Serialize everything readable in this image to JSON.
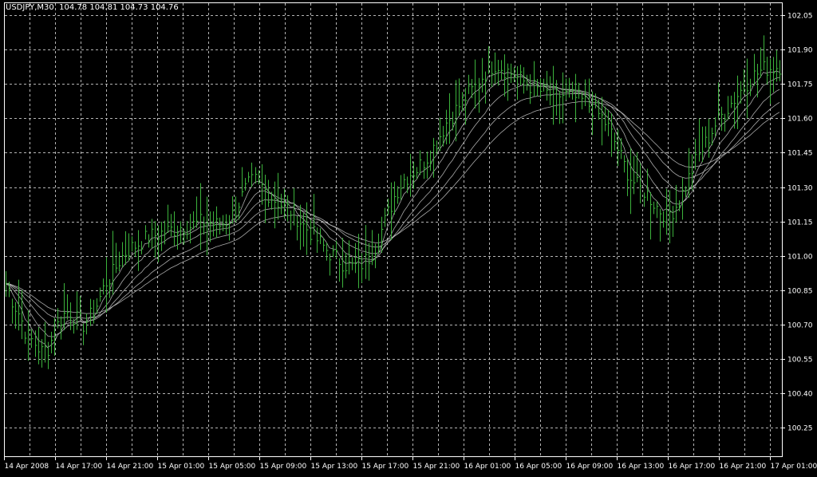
{
  "header": {
    "symbol_timeframe": "USDJPY,M30",
    "open": "104.78",
    "high": "104.81",
    "low": "104.73",
    "close": "104.76"
  },
  "colors": {
    "background": "#000000",
    "frame": "#ffffff",
    "grid": "#b4b4b4",
    "bars": "#3cb33c",
    "ma_lines": "#c8c8c8",
    "text": "#ffffff"
  },
  "chart_data": {
    "type": "line",
    "title": "USDJPY,M30",
    "price_axis": {
      "position": "right",
      "ticks": [
        "102.05",
        "101.90",
        "101.75",
        "101.60",
        "101.45",
        "101.30",
        "101.15",
        "101.00",
        "100.85",
        "100.70",
        "100.55",
        "100.40",
        "100.25"
      ],
      "ylim": [
        100.2,
        102.11
      ]
    },
    "time_axis": {
      "ticks": [
        "14 Apr 2008",
        "14 Apr 17:00",
        "14 Apr 21:00",
        "15 Apr 01:00",
        "15 Apr 05:00",
        "15 Apr 09:00",
        "15 Apr 13:00",
        "15 Apr 17:00",
        "15 Apr 21:00",
        "16 Apr 01:00",
        "16 Apr 05:00",
        "16 Apr 09:00",
        "16 Apr 13:00",
        "16 Apr 17:00",
        "16 Apr 21:00",
        "17 Apr 01:00"
      ]
    },
    "grid": true,
    "bars_note": "30-minute high-low bars, green",
    "closes": [
      100.88,
      100.8,
      100.74,
      100.65,
      100.62,
      100.58,
      100.6,
      100.68,
      100.74,
      100.76,
      100.72,
      100.7,
      100.74,
      100.8,
      100.88,
      100.92,
      100.98,
      101.02,
      101.04,
      101.06,
      101.08,
      101.09,
      101.1,
      101.11,
      101.12,
      101.13,
      101.13,
      101.14,
      101.15,
      101.14,
      101.13,
      101.15,
      101.18,
      101.24,
      101.3,
      101.33,
      101.3,
      101.27,
      101.24,
      101.22,
      101.2,
      101.17,
      101.13,
      101.1,
      101.06,
      101.03,
      101.0,
      100.98,
      100.96,
      100.95,
      100.96,
      100.99,
      101.04,
      101.12,
      101.2,
      101.28,
      101.33,
      101.36,
      101.38,
      101.42,
      101.46,
      101.52,
      101.58,
      101.62,
      101.66,
      101.7,
      101.73,
      101.78,
      101.82,
      101.84,
      101.82,
      101.8,
      101.78,
      101.76,
      101.74,
      101.72,
      101.71,
      101.7,
      101.7,
      101.7,
      101.69,
      101.68,
      101.66,
      101.63,
      101.6,
      101.55,
      101.48,
      101.4,
      101.34,
      101.3,
      101.28,
      101.24,
      101.2,
      101.18,
      101.2,
      101.25,
      101.32,
      101.4,
      101.46,
      101.52,
      101.58,
      101.62,
      101.66,
      101.7,
      101.74,
      101.78,
      101.8,
      101.82,
      101.82,
      101.83
    ],
    "moving_averages": {
      "count": 5,
      "type": "smoothed"
    }
  }
}
